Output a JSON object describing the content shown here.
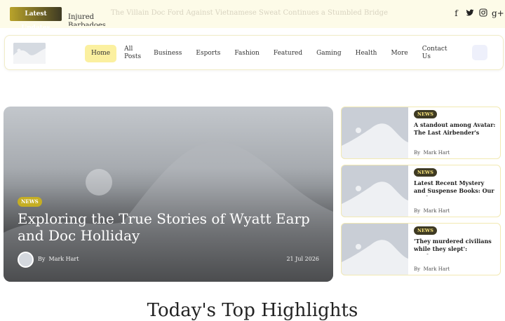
{
  "ticker": {
    "badge": "Latest Updates",
    "item": "Injured Barbadoes",
    "faded_item": "The Villain Doc Ford Against Vietnamese Sweat Continues a Stumbled Bridge",
    "social": [
      {
        "icon": "facebook-icon",
        "glyph": "f"
      },
      {
        "icon": "twitter-icon",
        "glyph": "t"
      },
      {
        "icon": "instagram-icon",
        "glyph": "◎"
      },
      {
        "icon": "google-plus-icon",
        "glyph": "g+"
      }
    ]
  },
  "nav": {
    "menu": [
      "Home",
      "All Posts",
      "Business",
      "Esports",
      "Fashion",
      "Featured",
      "Gaming",
      "Health",
      "More",
      "Contact Us"
    ],
    "active": "Home"
  },
  "hero": {
    "badge": "NEWS",
    "title": "Exploring the True Stories of Wyatt Earp and Doc Holliday",
    "by_prefix": "By",
    "author": "Mark Hart",
    "date": "21 Jul 2026"
  },
  "cards": [
    {
      "badge": "NEWS",
      "title": "A standout among Avatar: The Last Airbender's top…",
      "by_prefix": "By",
      "author": "Mark Hart"
    },
    {
      "badge": "NEWS",
      "title": "Latest Recent Mystery and Suspense Books: Our Book…",
      "by_prefix": "By",
      "author": "Mark Hart"
    },
    {
      "badge": "NEWS",
      "title": "'They murdered civilians while they slept': mayhem…",
      "by_prefix": "By",
      "author": "Mark Hart"
    }
  ],
  "section": {
    "title": "Today's Top Highlights"
  }
}
